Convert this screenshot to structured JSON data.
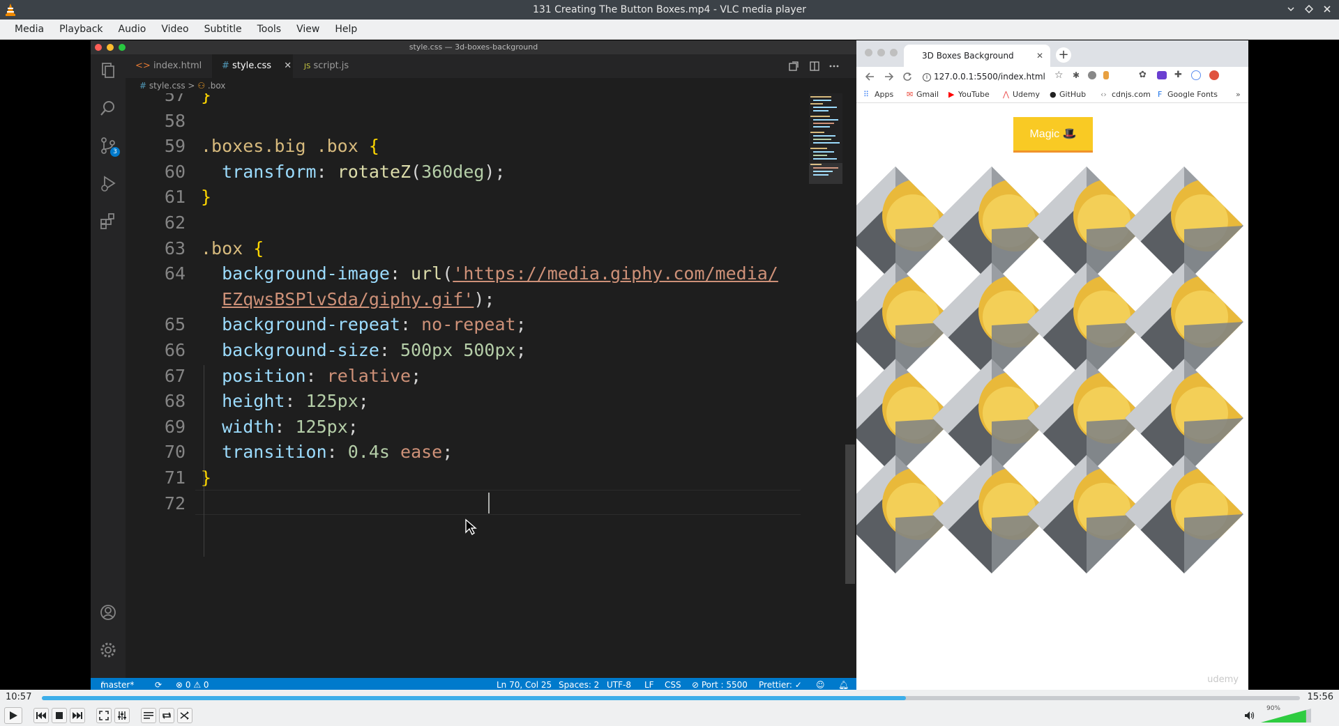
{
  "window": {
    "title": "131 Creating The Button Boxes.mp4 - VLC media player"
  },
  "menu": [
    "Media",
    "Playback",
    "Audio",
    "Video",
    "Subtitle",
    "Tools",
    "View",
    "Help"
  ],
  "vscode": {
    "title": "style.css — 3d-boxes-background",
    "tabs": [
      {
        "label": "index.html",
        "icon": "<>"
      },
      {
        "label": "style.css",
        "icon": "#"
      },
      {
        "label": "script.js",
        "icon": "JS"
      }
    ],
    "tab_close": "✕",
    "breadcrumb": {
      "file": "style.css",
      "sep": ">",
      "symbol": ".box"
    },
    "git_badge": "3",
    "lines": [
      {
        "n": "57",
        "code": "}"
      },
      {
        "n": "58",
        "code": ""
      },
      {
        "n": "59",
        "code": ".boxes.big .box {"
      },
      {
        "n": "60",
        "code": "  transform: rotateZ(360deg);"
      },
      {
        "n": "61",
        "code": "}"
      },
      {
        "n": "62",
        "code": ""
      },
      {
        "n": "63",
        "code": ".box {"
      },
      {
        "n": "64",
        "code": "  background-image: url('https://media.giphy.com/media/"
      },
      {
        "n": "",
        "code": "  EZqwsBSPlvSda/giphy.gif');"
      },
      {
        "n": "65",
        "code": "  background-repeat: no-repeat;"
      },
      {
        "n": "66",
        "code": "  background-size: 500px 500px;"
      },
      {
        "n": "67",
        "code": "  position: relative;"
      },
      {
        "n": "68",
        "code": "  height: 125px;"
      },
      {
        "n": "69",
        "code": "  width: 125px;"
      },
      {
        "n": "70",
        "code": "  transition: 0.4s ease;"
      },
      {
        "n": "71",
        "code": "}"
      },
      {
        "n": "72",
        "code": ""
      }
    ],
    "status": {
      "branch": "master*",
      "problems": "⊗ 0 ⚠ 0",
      "position": "Ln 70, Col 25",
      "spaces": "Spaces: 2",
      "encoding": "UTF-8",
      "eol": "LF",
      "language": "CSS",
      "port": "⊘ Port : 5500",
      "prettier": "Prettier: ✓"
    }
  },
  "browser": {
    "tab_title": "3D Boxes Background",
    "tab_close": "✕",
    "new_tab": "+",
    "url": "127.0.0.1:5500/index.html",
    "bookmarks": [
      "Apps",
      "Gmail",
      "YouTube",
      "Udemy",
      "GitHub",
      "cdnjs.com",
      "Google Fonts"
    ],
    "bookmarks_more": "»",
    "magic_button": "Magic 🎩",
    "watermark": "udemy"
  },
  "player": {
    "time_current": "10:57",
    "time_total": "15:56",
    "progress": 0.687,
    "volume_label": "90%",
    "volume": 0.9
  },
  "colors": {
    "vlc_bar": "#eff0f1",
    "vscode_bg": "#1e1e1e",
    "status_blue": "#007acc",
    "seek_blue": "#3daee9",
    "magic_yellow": "#f9ca24"
  }
}
